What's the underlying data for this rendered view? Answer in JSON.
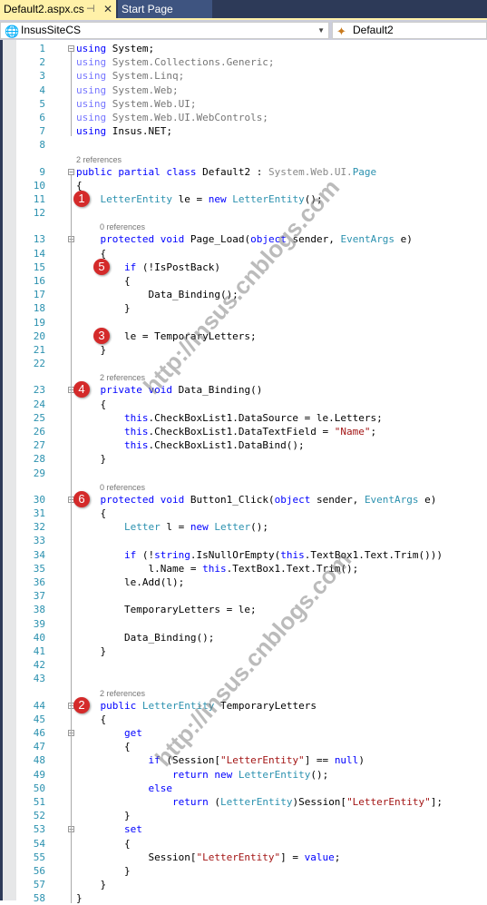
{
  "tabs": [
    {
      "label": "Default2.aspx.cs",
      "active": true,
      "pin_icon": "pin-icon",
      "close_icon": "close-icon"
    },
    {
      "label": "Start Page",
      "active": false
    }
  ],
  "navbar": {
    "project": {
      "label": "InsusSiteCS",
      "icon": "globe-icon"
    },
    "member": {
      "label": "Default2",
      "icon": "class-icon"
    }
  },
  "references": {
    "r9": "2 references",
    "r13": "0 references",
    "r23": "2 references",
    "r30": "0 references",
    "r44": "2 references"
  },
  "code_lines": [
    {
      "n": "1",
      "text": "using System;"
    },
    {
      "n": "2",
      "text": "using System.Collections.Generic;"
    },
    {
      "n": "3",
      "text": "using System.Linq;"
    },
    {
      "n": "4",
      "text": "using System.Web;"
    },
    {
      "n": "5",
      "text": "using System.Web.UI;"
    },
    {
      "n": "6",
      "text": "using System.Web.UI.WebControls;"
    },
    {
      "n": "7",
      "text": "using Insus.NET;"
    },
    {
      "n": "8",
      "text": ""
    },
    {
      "n": "9",
      "text": "public partial class Default2 : System.Web.UI.Page"
    },
    {
      "n": "10",
      "text": "{"
    },
    {
      "n": "11",
      "text": "    LetterEntity le = new LetterEntity();"
    },
    {
      "n": "12",
      "text": ""
    },
    {
      "n": "13",
      "text": "    protected void Page_Load(object sender, EventArgs e)"
    },
    {
      "n": "14",
      "text": "    {"
    },
    {
      "n": "15",
      "text": "        if (!IsPostBack)"
    },
    {
      "n": "16",
      "text": "        {"
    },
    {
      "n": "17",
      "text": "            Data_Binding();"
    },
    {
      "n": "18",
      "text": "        }"
    },
    {
      "n": "19",
      "text": ""
    },
    {
      "n": "20",
      "text": "        le = TemporaryLetters;"
    },
    {
      "n": "21",
      "text": "    }"
    },
    {
      "n": "22",
      "text": ""
    },
    {
      "n": "23",
      "text": "    private void Data_Binding()"
    },
    {
      "n": "24",
      "text": "    {"
    },
    {
      "n": "25",
      "text": "        this.CheckBoxList1.DataSource = le.Letters;"
    },
    {
      "n": "26",
      "text": "        this.CheckBoxList1.DataTextField = \"Name\";"
    },
    {
      "n": "27",
      "text": "        this.CheckBoxList1.DataBind();"
    },
    {
      "n": "28",
      "text": "    }"
    },
    {
      "n": "29",
      "text": ""
    },
    {
      "n": "30",
      "text": "    protected void Button1_Click(object sender, EventArgs e)"
    },
    {
      "n": "31",
      "text": "    {"
    },
    {
      "n": "32",
      "text": "        Letter l = new Letter();"
    },
    {
      "n": "33",
      "text": ""
    },
    {
      "n": "34",
      "text": "        if (!string.IsNullOrEmpty(this.TextBox1.Text.Trim()))"
    },
    {
      "n": "35",
      "text": "            l.Name = this.TextBox1.Text.Trim();"
    },
    {
      "n": "36",
      "text": "        le.Add(l);"
    },
    {
      "n": "37",
      "text": ""
    },
    {
      "n": "38",
      "text": "        TemporaryLetters = le;"
    },
    {
      "n": "39",
      "text": ""
    },
    {
      "n": "40",
      "text": "        Data_Binding();"
    },
    {
      "n": "41",
      "text": "    }"
    },
    {
      "n": "42",
      "text": ""
    },
    {
      "n": "43",
      "text": ""
    },
    {
      "n": "44",
      "text": "    public LetterEntity TemporaryLetters"
    },
    {
      "n": "45",
      "text": "    {"
    },
    {
      "n": "46",
      "text": "        get"
    },
    {
      "n": "47",
      "text": "        {"
    },
    {
      "n": "48",
      "text": "            if (Session[\"LetterEntity\"] == null)"
    },
    {
      "n": "49",
      "text": "                return new LetterEntity();"
    },
    {
      "n": "50",
      "text": "            else"
    },
    {
      "n": "51",
      "text": "                return (LetterEntity)Session[\"LetterEntity\"];"
    },
    {
      "n": "52",
      "text": "        }"
    },
    {
      "n": "53",
      "text": "        set"
    },
    {
      "n": "54",
      "text": "        {"
    },
    {
      "n": "55",
      "text": "            Session[\"LetterEntity\"] = value;"
    },
    {
      "n": "56",
      "text": "        }"
    },
    {
      "n": "57",
      "text": "    }"
    },
    {
      "n": "58",
      "text": "}"
    }
  ],
  "badges": [
    {
      "number": "1",
      "line": "11"
    },
    {
      "number": "2",
      "line": "44"
    },
    {
      "number": "3",
      "line": "20"
    },
    {
      "number": "4",
      "line": "23"
    },
    {
      "number": "5",
      "line": "15"
    },
    {
      "number": "6",
      "line": "30"
    }
  ],
  "watermark": "http://insus.cnblogs.com",
  "colors": {
    "keyword": "#0000ff",
    "type": "#2b91af",
    "string": "#a31515",
    "line_number": "#2b91af",
    "active_tab": "#fff1a8",
    "tabbar": "#2d3a58",
    "badge": "#d42a2a"
  }
}
